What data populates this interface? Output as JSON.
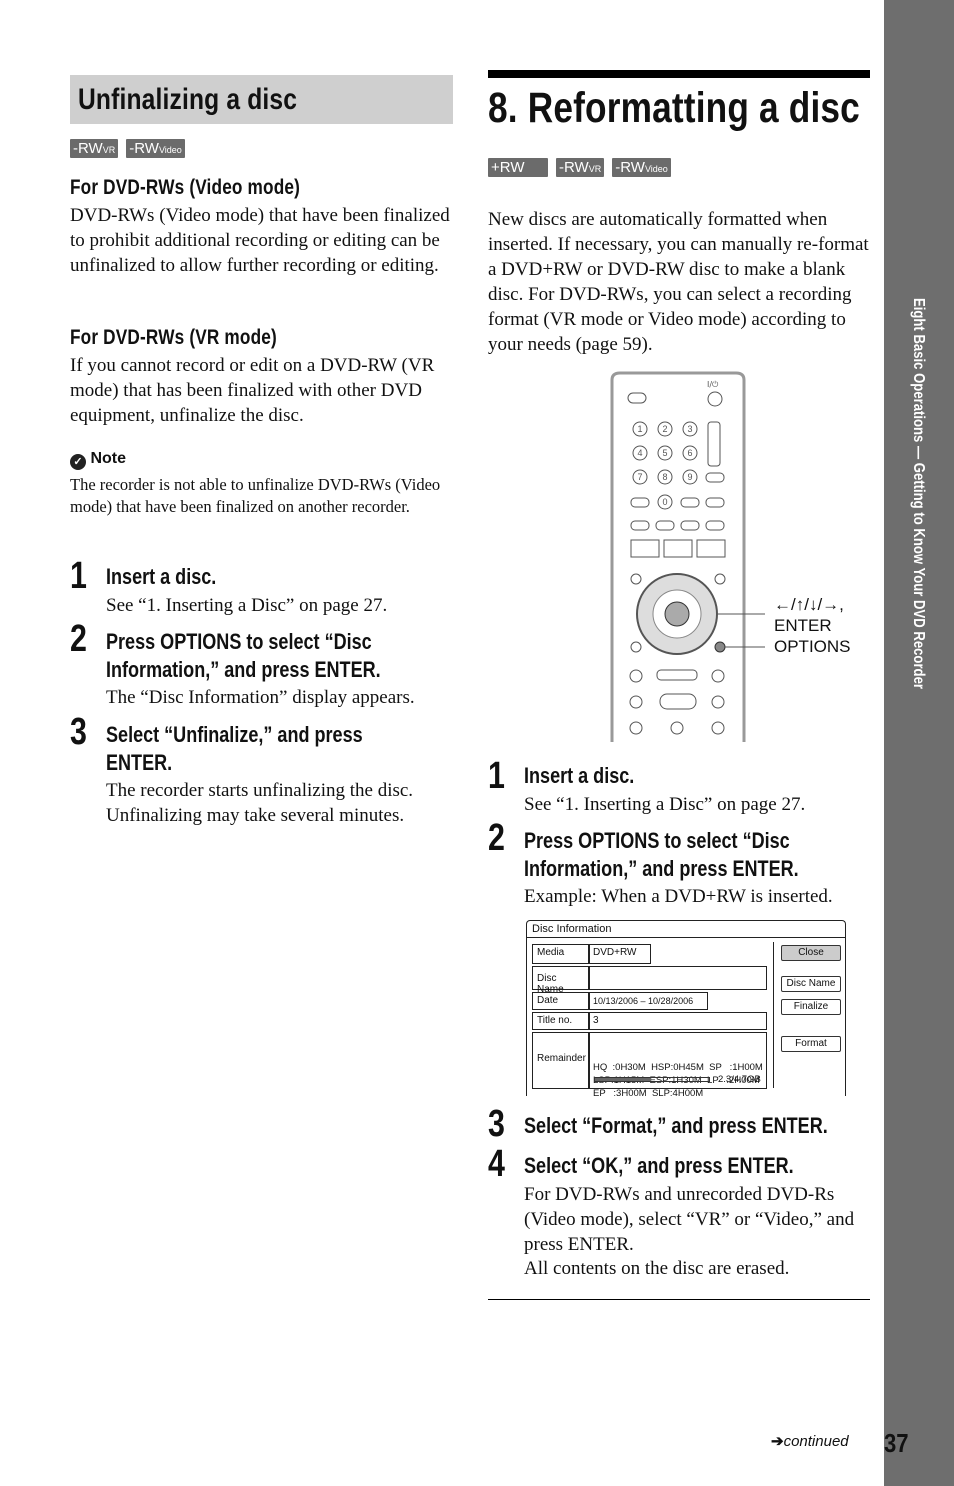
{
  "left": {
    "section_title": "Unfinalizing a disc",
    "badges": [
      {
        "main": "-RW",
        "sub": "VR"
      },
      {
        "main": "-RW",
        "sub": "Video"
      }
    ],
    "sub1_title": "For DVD-RWs (Video mode)",
    "sub1_text": "DVD-RWs (Video mode) that have been finalized to prohibit additional recording or editing can be unfinalized to allow further recording or editing.",
    "sub2_title": "For DVD-RWs (VR mode)",
    "sub2_text": "If you cannot record or edit on a DVD-RW (VR mode) that has been finalized with other DVD equipment, unfinalize the disc.",
    "note_label": "Note",
    "note_text": "The recorder is not able to unfinalize DVD-RWs (Video mode) that have been finalized on another recorder.",
    "steps": [
      {
        "num": "1",
        "title": "Insert a disc.",
        "text": "See “1. Inserting a Disc” on page 27."
      },
      {
        "num": "2",
        "title": "Press OPTIONS to select “Disc Information,” and press ENTER.",
        "title_l1": "Press OPTIONS to select “Disc",
        "title_l2": "Information,” and press ENTER.",
        "text": "The “Disc Information” display appears."
      },
      {
        "num": "3",
        "title_l1": "Select “Unfinalize,” and press",
        "title_l2": "ENTER.",
        "text": "The recorder starts unfinalizing the disc. Unfinalizing may take several minutes."
      }
    ]
  },
  "right": {
    "chapter_title": "8. Reformatting a disc",
    "badges": [
      {
        "main": "+RW",
        "sub": ""
      },
      {
        "main": "-RW",
        "sub": "VR"
      },
      {
        "main": "-RW",
        "sub": "Video"
      }
    ],
    "intro": "New discs are automatically formatted when inserted. If necessary, you can manually re-format a DVD+RW or DVD-RW disc to make a blank disc. For DVD-RWs, you can select a recording format (VR mode or Video mode) according to your needs (page 59).",
    "remote_labels": {
      "arrows": "←/↑/↓/→,",
      "enter": "ENTER",
      "options": "OPTIONS",
      "power": "I/⏻"
    },
    "steps": [
      {
        "num": "1",
        "title": "Insert a disc.",
        "text": "See “1. Inserting a Disc” on page 27."
      },
      {
        "num": "2",
        "title_l1": "Press OPTIONS to select “Disc",
        "title_l2": "Information,” and press ENTER.",
        "text": "Example: When a DVD+RW is inserted."
      },
      {
        "num": "3",
        "title": "Select “Format,” and press ENTER."
      },
      {
        "num": "4",
        "title": "Select “OK,” and press ENTER.",
        "text": "For DVD-RWs and unrecorded DVD-Rs (Video mode), select “VR” or “Video,” and press ENTER.",
        "text2": "All contents on the disc are erased."
      }
    ],
    "disc_info": {
      "title": "Disc Information",
      "media_label": "Media",
      "media": "DVD+RW",
      "name_label": "Disc Name",
      "name": "",
      "date_label": "Date",
      "date": "10/13/2006 – 10/28/2006",
      "title_label": "Title no.",
      "title_no": "3",
      "remainder_label": "Remainder",
      "remainder_lines": [
        "HQ  :0H30M  HSP:0H45M  SP   :1H00M",
        "LSP:1H15M  ESP:1H30M  LP   :2H00M",
        "EP   :3H00M  SLP:4H00M"
      ],
      "usage": "2.3/4.7GB",
      "usage_fraction": 0.49,
      "buttons": [
        "Close",
        "Disc Name",
        "Finalize",
        "Format"
      ]
    }
  },
  "footer": {
    "continued": "continued",
    "page_number": "37"
  },
  "sidebar": {
    "text": "Eight Basic Operations — Getting to Know Your DVD Recorder",
    "color": "#6e6e6e"
  }
}
